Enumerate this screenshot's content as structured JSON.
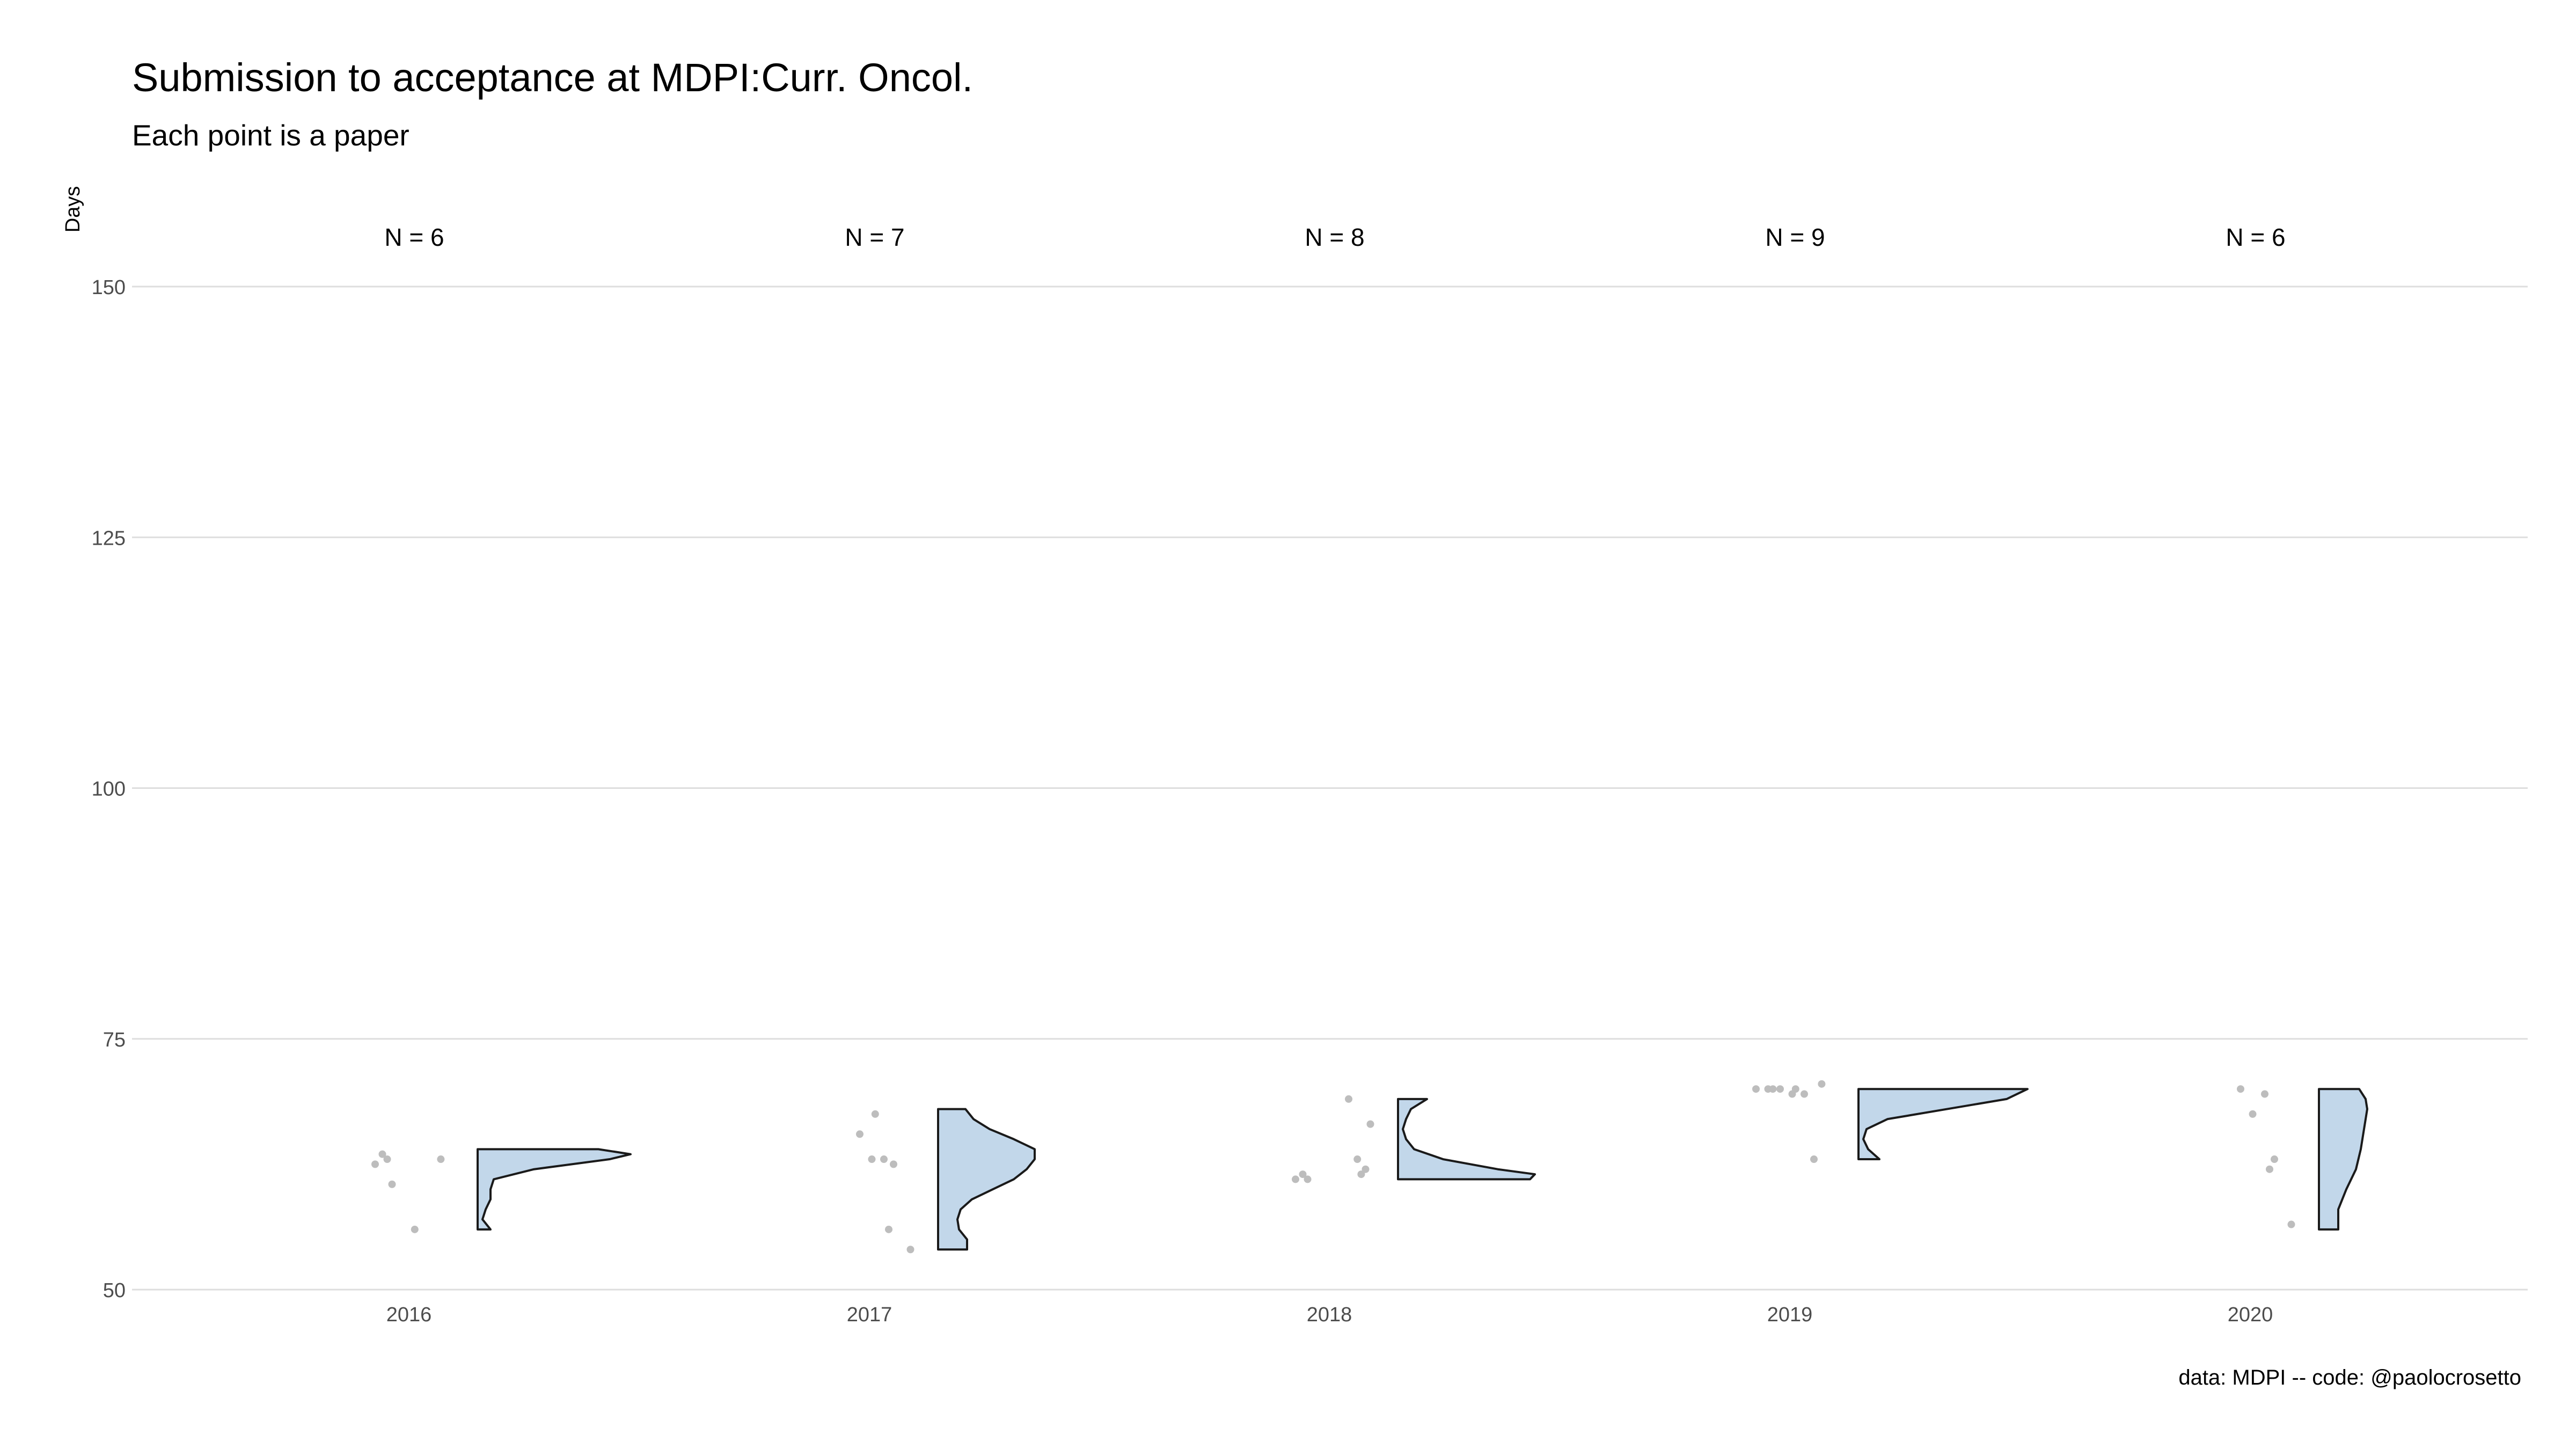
{
  "chart_data": {
    "type": "violin",
    "title": "Submission to acceptance at MDPI:Curr. Oncol.",
    "subtitle": "Each point is a paper",
    "ylabel": "Days",
    "xlabel": "",
    "caption": "data: MDPI -- code: @paolocrosetto",
    "ylim": [
      50,
      150
    ],
    "yticks": [
      50,
      75,
      100,
      125,
      150
    ],
    "grid": true,
    "categories": [
      "2016",
      "2017",
      "2018",
      "2019",
      "2020"
    ],
    "counts": [
      "N = 6",
      "N = 7",
      "N = 8",
      "N = 9",
      "N = 6"
    ],
    "points": {
      "2016": [
        63.5,
        63,
        63,
        62.5,
        60.5,
        56
      ],
      "2017": [
        67.5,
        65.5,
        63,
        63,
        62.5,
        56,
        54
      ],
      "2018": [
        69,
        66.5,
        63,
        62,
        61.5,
        61.5,
        61,
        61
      ],
      "2019": [
        70.5,
        70,
        70,
        70,
        70,
        70,
        69.5,
        69.5,
        63
      ],
      "2020": [
        70,
        69.5,
        67.5,
        63,
        62,
        56.5
      ]
    },
    "violins": {
      "2016": [
        [
          56,
          0.08
        ],
        [
          57,
          0.03
        ],
        [
          58,
          0.05
        ],
        [
          59,
          0.08
        ],
        [
          60,
          0.08
        ],
        [
          61,
          0.1
        ],
        [
          62,
          0.35
        ],
        [
          63,
          0.82
        ],
        [
          63.5,
          0.95
        ],
        [
          64,
          0.75
        ]
      ],
      "2017": [
        [
          54,
          0.18
        ],
        [
          55,
          0.18
        ],
        [
          56,
          0.13
        ],
        [
          57,
          0.12
        ],
        [
          58,
          0.14
        ],
        [
          59,
          0.21
        ],
        [
          60,
          0.34
        ],
        [
          61,
          0.47
        ],
        [
          62,
          0.55
        ],
        [
          63,
          0.6
        ],
        [
          64,
          0.6
        ],
        [
          65,
          0.47
        ],
        [
          66,
          0.32
        ],
        [
          67,
          0.22
        ],
        [
          68,
          0.17
        ]
      ],
      "2018": [
        [
          61,
          0.82
        ],
        [
          61.5,
          0.85
        ],
        [
          62,
          0.62
        ],
        [
          63,
          0.28
        ],
        [
          64,
          0.1
        ],
        [
          65,
          0.05
        ],
        [
          66,
          0.03
        ],
        [
          67,
          0.05
        ],
        [
          68,
          0.08
        ],
        [
          69,
          0.18
        ]
      ],
      "2019": [
        [
          63,
          0.13
        ],
        [
          64,
          0.06
        ],
        [
          65,
          0.03
        ],
        [
          66,
          0.05
        ],
        [
          67,
          0.18
        ],
        [
          68,
          0.55
        ],
        [
          69,
          0.92
        ],
        [
          70,
          1.05
        ]
      ],
      "2020": [
        [
          56,
          0.12
        ],
        [
          58,
          0.12
        ],
        [
          60,
          0.17
        ],
        [
          62,
          0.23
        ],
        [
          64,
          0.26
        ],
        [
          66,
          0.28
        ],
        [
          68,
          0.3
        ],
        [
          69,
          0.29
        ],
        [
          70,
          0.25
        ]
      ]
    },
    "colors": {
      "violin_fill": "#c2d7ea",
      "violin_stroke": "#1a1a1a",
      "point": "#bdbdbd",
      "grid": "#dedede",
      "tick_text": "#4d4d4d"
    }
  }
}
